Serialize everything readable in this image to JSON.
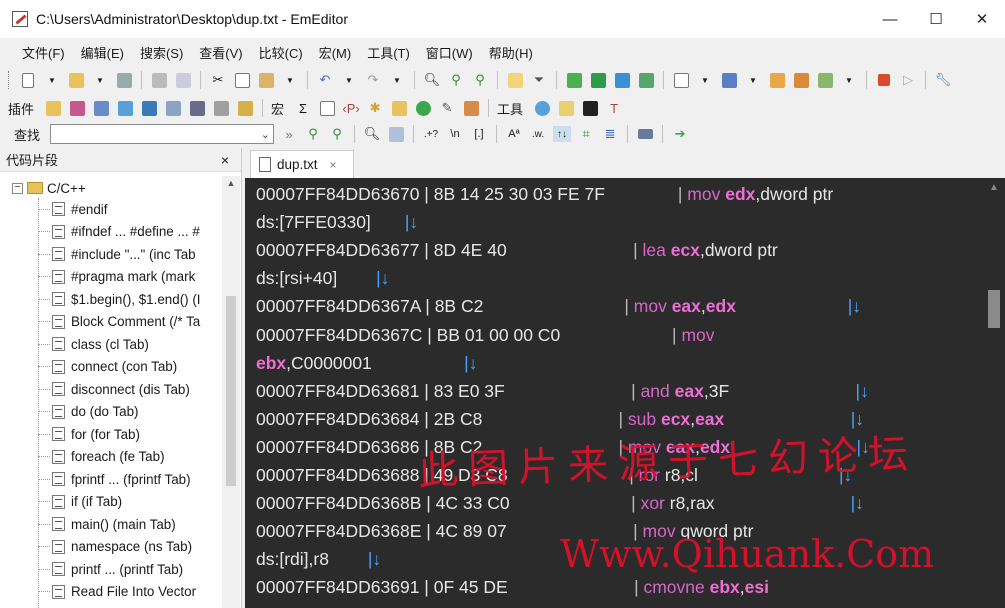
{
  "window": {
    "title": "C:\\Users\\Administrator\\Desktop\\dup.txt - EmEditor",
    "minimize": "—",
    "maximize": "☐",
    "close": "✕"
  },
  "menu": [
    "文件(F)",
    "编辑(E)",
    "搜索(S)",
    "查看(V)",
    "比较(C)",
    "宏(M)",
    "工具(T)",
    "窗口(W)",
    "帮助(H)"
  ],
  "toolbar2": {
    "plugins_label": "插件",
    "macro_label": "宏",
    "sigma": "Σ",
    "tools_label": "工具"
  },
  "findbar": {
    "label": "查找",
    "value": "",
    "dropdown": "⌄",
    "opts": [
      ".+?",
      "\\n",
      "[.]",
      "Aª",
      ".w.",
      "↑↓"
    ]
  },
  "snippets": {
    "header": "代码片段",
    "close": "×",
    "root": "C/C++",
    "expander": "−",
    "items": [
      "#endif",
      "#ifndef ... #define ... #",
      "#include \"...\"  (inc Tab",
      "#pragma mark  (mark",
      "$1.begin(), $1.end()  (I",
      "Block Comment  (/* Ta",
      "class  (cl Tab)",
      "connect  (con Tab)",
      "disconnect  (dis Tab)",
      "do  (do Tab)",
      "for  (for Tab)",
      "foreach  (fe Tab)",
      "fprintf ...  (fprintf Tab)",
      "if  (if Tab)",
      "main()  (main Tab)",
      "namespace  (ns Tab)",
      "printf ...  (printf Tab)",
      "Read File Into Vector"
    ]
  },
  "tab": {
    "name": "dup.txt",
    "close": "×"
  },
  "editor": {
    "lines": [
      [
        {
          "t": "00007FF84DD63670 | 8B 14 25 30 03 FE 7F               "
        },
        {
          "t": "| ",
          "c": "bar"
        },
        {
          "t": "mov ",
          "c": "kw"
        },
        {
          "t": "edx",
          "c": "reg"
        },
        {
          "t": ",dword ptr"
        }
      ],
      [
        {
          "t": "ds:[7FFE0330]       "
        },
        {
          "t": "|↓",
          "c": "arrow-g"
        }
      ],
      [
        {
          "t": "00007FF84DD63677 | 8D 4E 40                          "
        },
        {
          "t": "| ",
          "c": "bar"
        },
        {
          "t": "lea ",
          "c": "kw"
        },
        {
          "t": "ecx",
          "c": "reg"
        },
        {
          "t": ",dword ptr"
        }
      ],
      [
        {
          "t": "ds:[rsi+40]        "
        },
        {
          "t": "|↓",
          "c": "arrow-g"
        }
      ],
      [
        {
          "t": "00007FF84DD6367A | 8B C2                             "
        },
        {
          "t": "| ",
          "c": "bar"
        },
        {
          "t": "mov ",
          "c": "kw"
        },
        {
          "t": "eax",
          "c": "reg"
        },
        {
          "t": ",",
          "c": ""
        },
        {
          "t": "edx",
          "c": "reg"
        },
        {
          "t": "                       "
        },
        {
          "t": "|↓",
          "c": "arrow-g"
        }
      ],
      [
        {
          "t": "00007FF84DD6367C | BB 01 00 00 C0                       "
        },
        {
          "t": "| ",
          "c": "bar"
        },
        {
          "t": "mov",
          "c": "kw"
        }
      ],
      [
        {
          "t": "ebx",
          "c": "reg"
        },
        {
          "t": ",C0000001                   "
        },
        {
          "t": "|↓",
          "c": "arrow-g"
        }
      ],
      [
        {
          "t": "00007FF84DD63681 | 83 E0 3F                          "
        },
        {
          "t": "| ",
          "c": "bar"
        },
        {
          "t": "and ",
          "c": "kw"
        },
        {
          "t": "eax",
          "c": "reg"
        },
        {
          "t": ",3F                          "
        },
        {
          "t": "|↓",
          "c": "arrow-g"
        }
      ],
      [
        {
          "t": "00007FF84DD63684 | 2B C8                            "
        },
        {
          "t": "| ",
          "c": "bar"
        },
        {
          "t": "sub ",
          "c": "kw"
        },
        {
          "t": "ecx",
          "c": "reg"
        },
        {
          "t": ",",
          "c": ""
        },
        {
          "t": "eax",
          "c": "reg"
        },
        {
          "t": "                          "
        },
        {
          "t": "|↓",
          "c": "arrow-g"
        }
      ],
      [
        {
          "t": "00007FF84DD63686 | 8B C2                            "
        },
        {
          "t": "| ",
          "c": "bar"
        },
        {
          "t": "mov ",
          "c": "kw"
        },
        {
          "t": "eax",
          "c": "reg"
        },
        {
          "t": ",",
          "c": ""
        },
        {
          "t": "edx",
          "c": "reg"
        },
        {
          "t": "                          "
        },
        {
          "t": "|↓",
          "c": "arrow-g"
        }
      ],
      [
        {
          "t": "00007FF84DD63688 | 49 D3 C8                         "
        },
        {
          "t": "| ",
          "c": "bar"
        },
        {
          "t": "ror ",
          "c": "kw"
        },
        {
          "t": "r8,cl                             "
        },
        {
          "t": "|↓",
          "c": "arrow-g"
        }
      ],
      [
        {
          "t": "00007FF84DD6368B | 4C 33 C0                         "
        },
        {
          "t": "| ",
          "c": "bar"
        },
        {
          "t": "xor ",
          "c": "kw"
        },
        {
          "t": "r8,rax                            "
        },
        {
          "t": "|↓",
          "c": "arrow-g"
        }
      ],
      [
        {
          "t": "00007FF84DD6368E | 4C 89 07                          "
        },
        {
          "t": "| ",
          "c": "bar"
        },
        {
          "t": "mov ",
          "c": "kw"
        },
        {
          "t": "qword ptr"
        }
      ],
      [
        {
          "t": "ds:[rdi],r8        "
        },
        {
          "t": "|↓",
          "c": "arrow-g"
        }
      ],
      [
        {
          "t": "00007FF84DD63691 | 0F 45 DE                          "
        },
        {
          "t": "| ",
          "c": "bar"
        },
        {
          "t": "cmovne ",
          "c": "kw"
        },
        {
          "t": "ebx",
          "c": "reg"
        },
        {
          "t": ",",
          "c": ""
        },
        {
          "t": "esi",
          "c": "reg"
        }
      ]
    ]
  },
  "watermark": {
    "line1": "此图片来源于七幻论坛",
    "line2": "Www.Qihuank.Com"
  }
}
